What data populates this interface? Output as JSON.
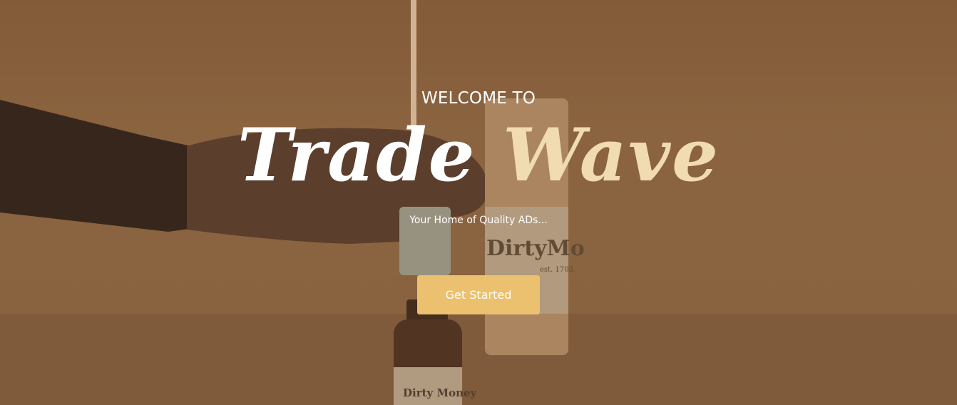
{
  "hero": {
    "welcome_text": "WELCOME TO",
    "brand_part_1": "Trade",
    "brand_part_2": "Wave",
    "tagline": "Your Home of Quality ADs...",
    "cta_label": "Get Started",
    "photo_text": {
      "tube_brand": "DirtyMo",
      "tube_est": "est. 1703",
      "bottle_brand": "Dirty Money"
    }
  },
  "colors": {
    "background": "#8a6341",
    "brand_accent": "#f1dbb0",
    "button": "#ebc06e",
    "text": "#ffffff"
  }
}
